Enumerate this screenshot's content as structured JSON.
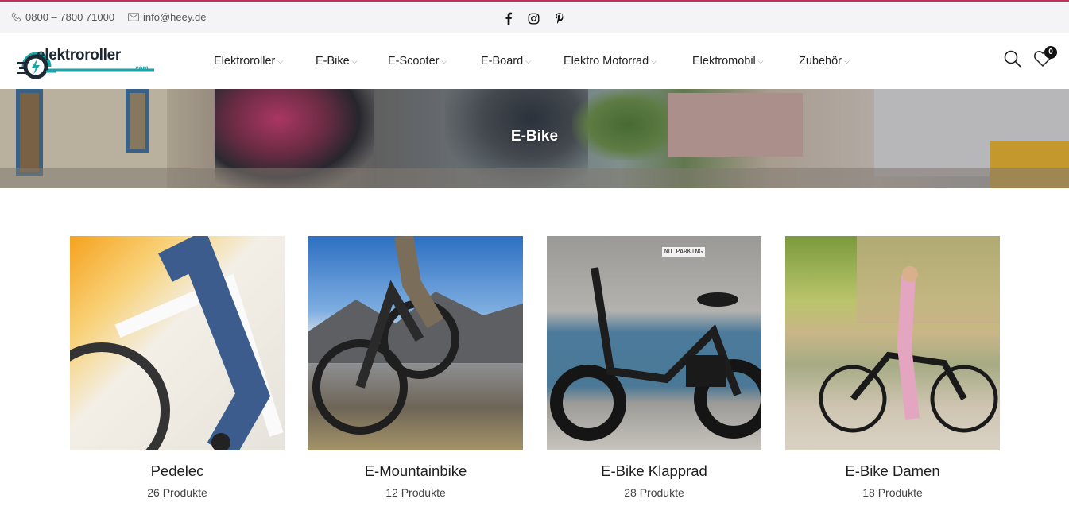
{
  "topbar": {
    "phone": "0800 – 7800 71000",
    "email": "info@heey.de",
    "social": [
      "facebook-icon",
      "instagram-icon",
      "pinterest-icon"
    ]
  },
  "header": {
    "logo_text": "elektroroller",
    "logo_suffix": ".com",
    "nav": [
      {
        "label": "Elektroroller"
      },
      {
        "label": "E-Bike"
      },
      {
        "label": "E-Scooter"
      },
      {
        "label": "E-Board"
      },
      {
        "label": "Elektro Motorrad"
      },
      {
        "label": "Elektromobil"
      },
      {
        "label": "Zubehör"
      }
    ],
    "wishlist_count": "0"
  },
  "banner": {
    "title": "E-Bike",
    "sign_text": "NO PARKING"
  },
  "categories": [
    {
      "name": "Pedelec",
      "count": "26 Produkte"
    },
    {
      "name": "E-Mountainbike",
      "count": "12 Produkte"
    },
    {
      "name": "E-Bike Klapprad",
      "count": "28 Produkte"
    },
    {
      "name": "E-Bike Damen",
      "count": "18 Produkte"
    }
  ],
  "colors": {
    "accent": "#c0325a",
    "brand_teal": "#1aa5a8",
    "brand_dark": "#1d2833"
  }
}
